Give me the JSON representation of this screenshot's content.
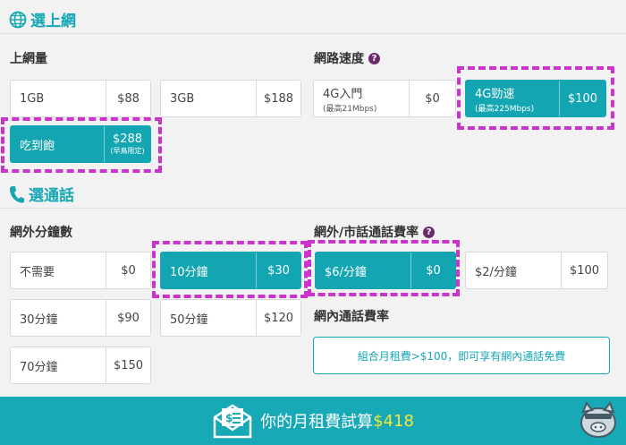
{
  "internet": {
    "section_title": "選上網",
    "data_label": "上網量",
    "speed_label": "網路速度",
    "data_options": [
      {
        "name": "1GB",
        "price": "$88"
      },
      {
        "name": "3GB",
        "price": "$188"
      },
      {
        "name": "吃到飽",
        "price": "$288",
        "note": "(早鳥限定)"
      }
    ],
    "speed_options": [
      {
        "name": "4G入門",
        "sub": "(最高21Mbps)",
        "price": "$0"
      },
      {
        "name": "4G勁速",
        "sub": "(最高225Mbps)",
        "price": "$100"
      }
    ]
  },
  "calls": {
    "section_title": "選通話",
    "minutes_label": "網外分鐘數",
    "rate_label": "網外/市話通話費率",
    "onnet_label": "網內通話費率",
    "minutes_options": [
      {
        "name": "不需要",
        "price": "$0"
      },
      {
        "name": "10分鐘",
        "price": "$30"
      },
      {
        "name": "30分鐘",
        "price": "$90"
      },
      {
        "name": "50分鐘",
        "price": "$120"
      },
      {
        "name": "70分鐘",
        "price": "$150"
      }
    ],
    "rate_options": [
      {
        "name": "$6/分鐘",
        "price": "$0"
      },
      {
        "name": "$2/分鐘",
        "price": "$100"
      }
    ],
    "onnet_notice": "組合月租費>$100，即可享有網內通話免費"
  },
  "footer": {
    "text": "你的月租費試算",
    "total": "$418"
  },
  "help_glyph": "?",
  "colors": {
    "accent": "#16a7b5",
    "highlight": "#cc33cc",
    "total": "#f5e53a"
  }
}
